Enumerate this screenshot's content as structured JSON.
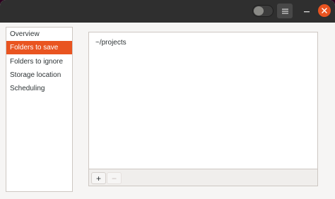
{
  "header": {
    "toggle_state": "off",
    "menu_icon": "hamburger-menu-icon",
    "minimize_icon": "minimize-icon",
    "close_icon": "close-icon",
    "accent_color": "#e95420"
  },
  "sidebar": {
    "selected_index": 1,
    "items": [
      {
        "label": "Overview"
      },
      {
        "label": "Folders to save"
      },
      {
        "label": "Folders to ignore"
      },
      {
        "label": "Storage location"
      },
      {
        "label": "Scheduling"
      }
    ]
  },
  "main": {
    "folders": [
      "~/projects"
    ],
    "add_label": "+",
    "remove_label": "−"
  }
}
